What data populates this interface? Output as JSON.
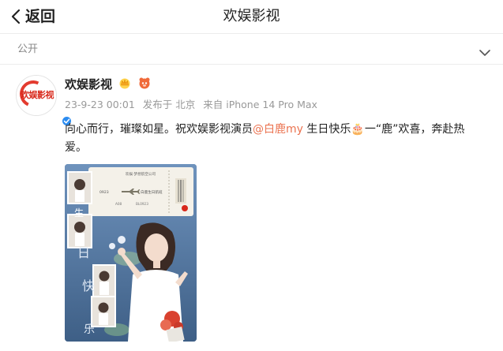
{
  "navbar": {
    "back_label": "返回",
    "title": "欢娱影视"
  },
  "visibility": {
    "label": "公开"
  },
  "post": {
    "username": "欢娱影视",
    "avatar_text": "欢娱影视",
    "time": "23-9-23 00:01",
    "location": "发布于 北京",
    "device": "来自 iPhone 14 Pro Max",
    "text_before": "向心而行，璀璨如星。祝欢娱影视演员",
    "mention": "@白鹿my",
    "text_after": " 生日快乐🎂一“鹿”欢喜，奔赴热爱。",
    "poster": {
      "ticket_top": "欢娱·梦想航空公司",
      "ticket_flight": "0923",
      "ticket_route": "白鹿生日航班",
      "ticket_seat": "A08",
      "ticket_gate": "BL0923",
      "side_chars": [
        "生",
        "日",
        "快",
        "乐"
      ]
    }
  },
  "colors": {
    "accent_mention": "#eb7350",
    "avatar_red": "#e33b2f",
    "verified_blue": "#2c8cf0",
    "poster_blue": "#5b7fa8"
  }
}
